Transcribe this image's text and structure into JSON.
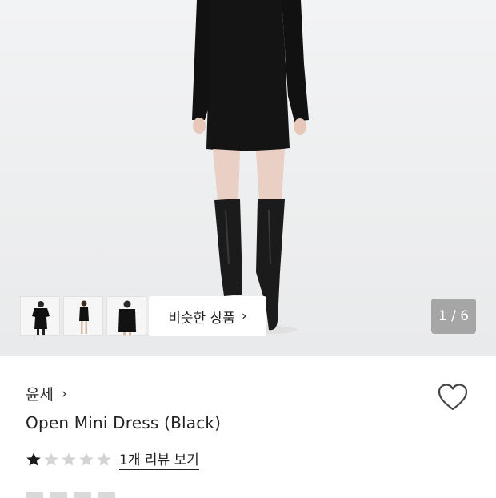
{
  "hero": {
    "thumbnails": [
      "thumbnail-1",
      "thumbnail-2",
      "thumbnail-3"
    ],
    "similar_button_label": "비슷한 상품",
    "similar_button_icon": "chevron-right-icon",
    "counter": "1 / 6"
  },
  "product": {
    "brand": "윤세",
    "brand_icon": "chevron-right-icon",
    "title": "Open Mini Dress (Black)",
    "rating": 1,
    "rating_max": 5,
    "review_link": "1개 리뷰 보기",
    "wishlist_icon": "heart-outline-icon"
  },
  "colors": {
    "star_filled": "#1a1a1a",
    "star_empty": "#d3d3d3",
    "dress": "#141414"
  }
}
